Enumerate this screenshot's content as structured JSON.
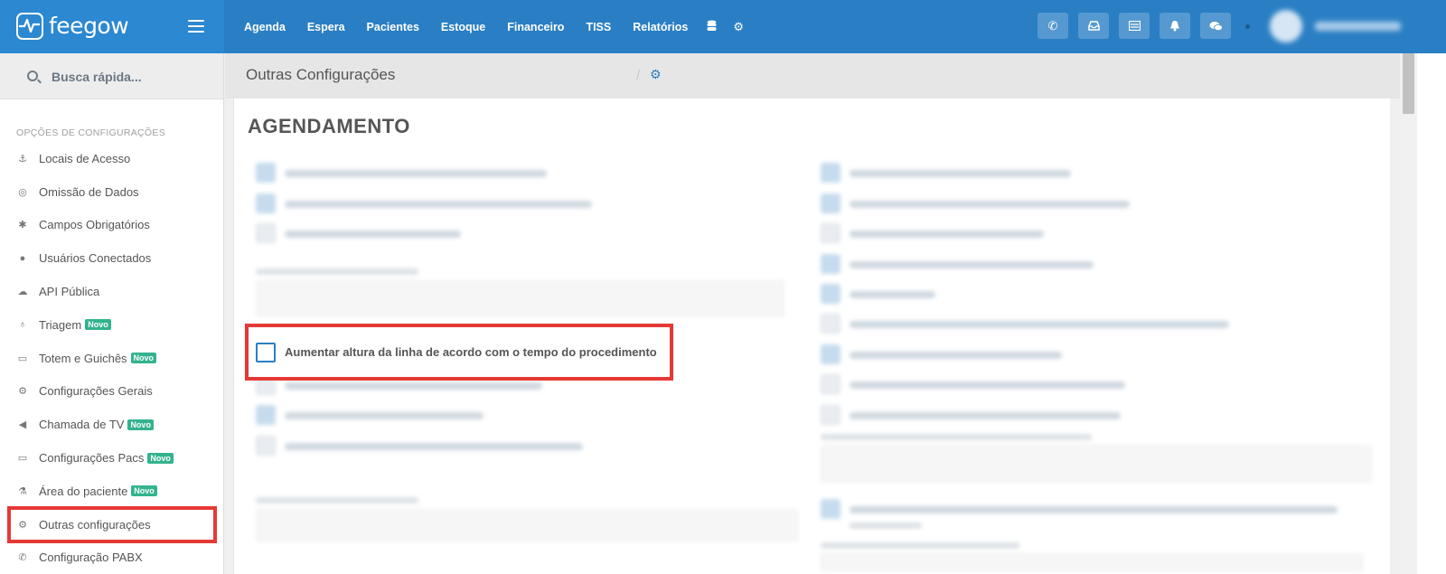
{
  "topbar": {
    "logo_text": "feegow",
    "nav": [
      "Agenda",
      "Espera",
      "Pacientes",
      "Estoque",
      "Financeiro",
      "TISS",
      "Relatórios"
    ],
    "nav_icons": [
      "database-icon",
      "gear-icon"
    ],
    "action_buttons": [
      "phone-icon",
      "inbox-icon",
      "list-icon",
      "bell-icon",
      "chat-icon"
    ],
    "user": "blurred-user-avatar"
  },
  "sidebar": {
    "search_label": "Busca rápida...",
    "section_title": "OPÇÕES DE CONFIGURAÇÕES",
    "items": [
      {
        "label": "Locais de Acesso",
        "icon": "anchor-icon",
        "glyph": "⚓",
        "badge": ""
      },
      {
        "label": "Omissão de Dados",
        "icon": "eye-slash-icon",
        "glyph": "◎",
        "badge": ""
      },
      {
        "label": "Campos Obrigatórios",
        "icon": "asterisk-icon",
        "glyph": "✱",
        "badge": ""
      },
      {
        "label": "Usuários Conectados",
        "icon": "user-icon",
        "glyph": "●",
        "badge": ""
      },
      {
        "label": "API Pública",
        "icon": "cloud-icon",
        "glyph": "☁",
        "badge": ""
      },
      {
        "label": "Triagem",
        "icon": "stethoscope-icon",
        "glyph": "♁",
        "badge": "Novo"
      },
      {
        "label": "Totem e Guichês",
        "icon": "laptop-icon",
        "glyph": "▭",
        "badge": "Novo"
      },
      {
        "label": "Configurações Gerais",
        "icon": "cogs-icon",
        "glyph": "⚙",
        "badge": ""
      },
      {
        "label": "Chamada de TV",
        "icon": "bullhorn-icon",
        "glyph": "◀",
        "badge": "Novo"
      },
      {
        "label": "Configurações Pacs",
        "icon": "laptop-icon",
        "glyph": "▭",
        "badge": "Novo"
      },
      {
        "label": "Área do paciente",
        "icon": "flask-icon",
        "glyph": "⚗",
        "badge": "Novo"
      },
      {
        "label": "Outras configurações",
        "icon": "cogs-icon",
        "glyph": "⚙",
        "badge": ""
      },
      {
        "label": "Configuração PABX",
        "icon": "phone-icon",
        "glyph": "✆",
        "badge": ""
      }
    ],
    "active_index": 11
  },
  "breadcrumb": {
    "title": "Outras Configurações",
    "separator": "/",
    "icon": "cogs-icon"
  },
  "main": {
    "heading": "AGENDAMENTO",
    "highlighted_option": {
      "label": "Aumentar altura da linha de acordo com o tempo do procedimento",
      "checked": false
    }
  },
  "colors": {
    "topbar": "#2a7fc4",
    "brand": "#2b88d1",
    "badge": "#33b38f",
    "highlight": "#e53935"
  }
}
